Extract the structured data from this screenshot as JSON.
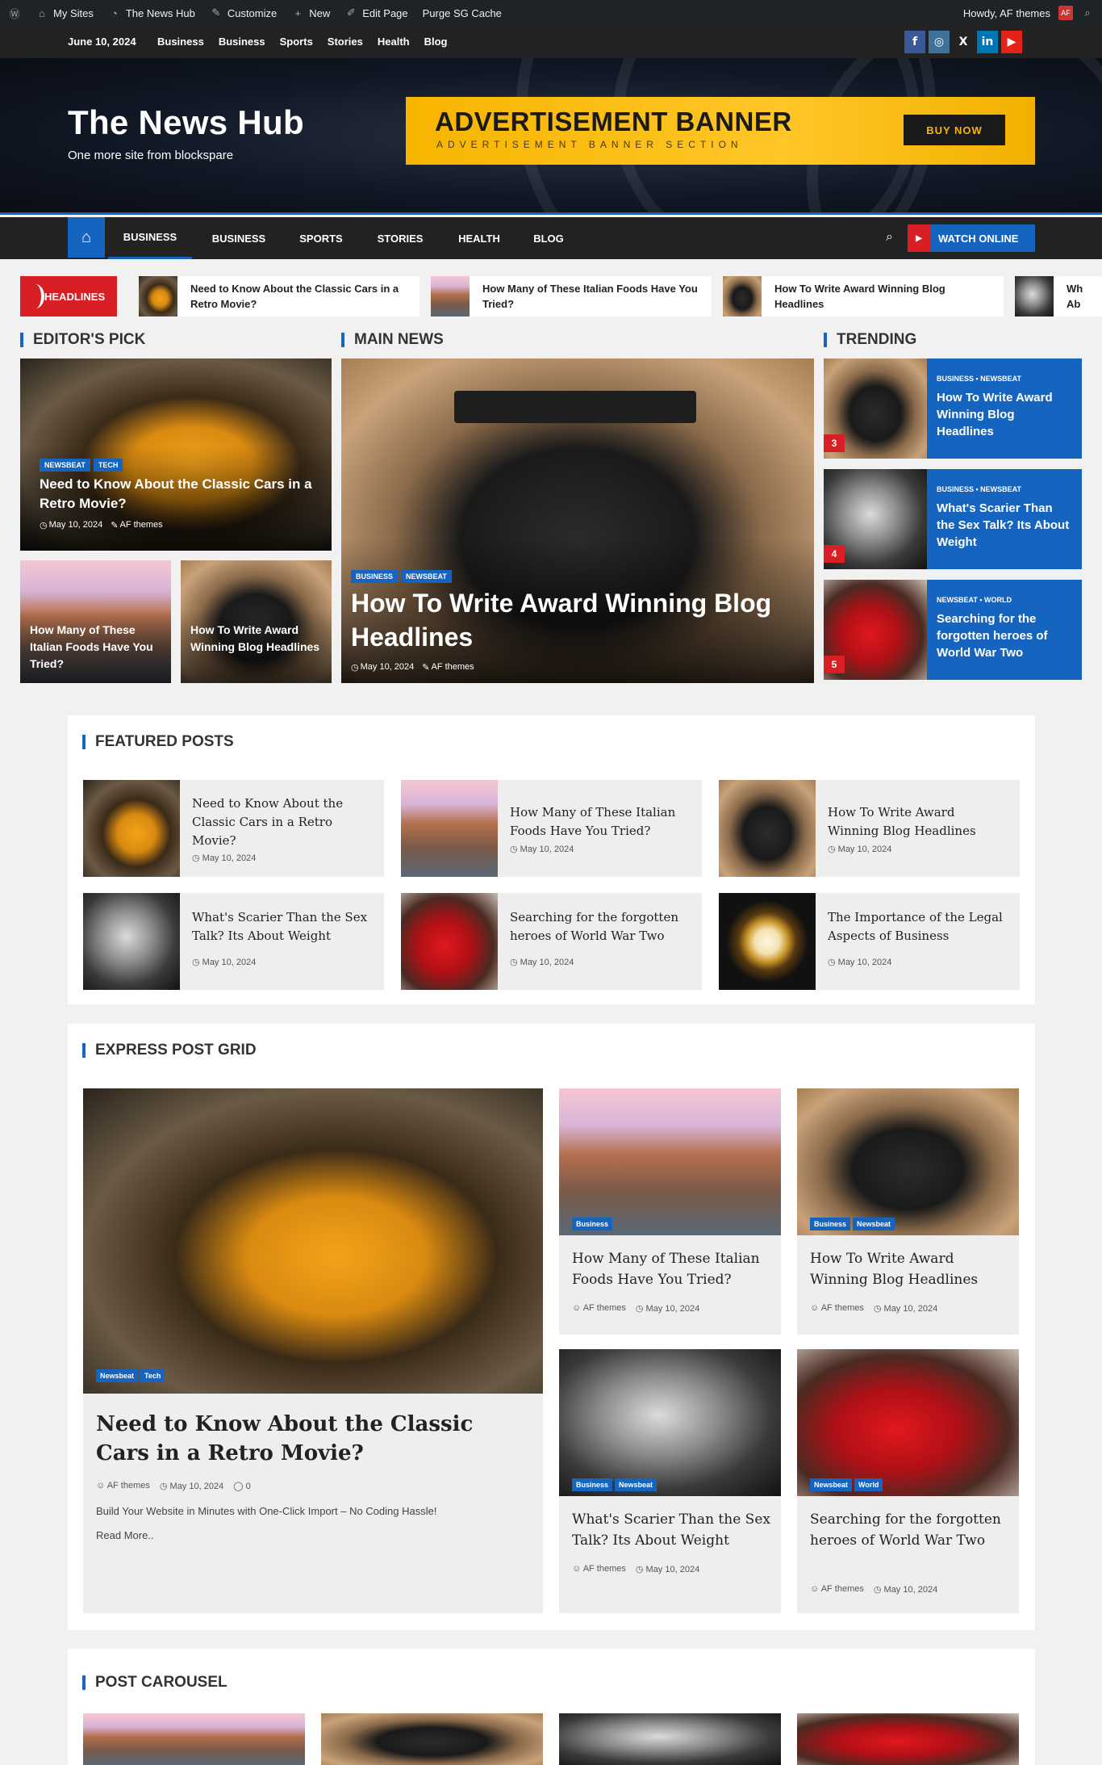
{
  "admin_bar": {
    "my_sites": "My Sites",
    "site_name": "The News Hub",
    "customize": "Customize",
    "new": "New",
    "edit_page": "Edit Page",
    "purge": "Purge SG Cache",
    "howdy": "Howdy, AF themes"
  },
  "top_bar": {
    "date": "June 10, 2024",
    "menu": [
      "Business",
      "Business",
      "Sports",
      "Stories",
      "Health",
      "Blog"
    ],
    "social": [
      "facebook-icon",
      "instagram-icon",
      "x-icon",
      "linkedin-icon",
      "youtube-icon"
    ],
    "social_labels": [
      "f",
      "◎",
      "X",
      "in",
      "▶"
    ]
  },
  "header": {
    "title": "The News Hub",
    "tagline": "One more site from blockspare",
    "ad_title": "ADVERTISEMENT BANNER",
    "ad_sub": "ADVERTISEMENT BANNER SECTION",
    "ad_button": "BUY NOW"
  },
  "nav": {
    "items": [
      "BUSINESS",
      "BUSINESS",
      "SPORTS",
      "STORIES",
      "HEALTH",
      "BLOG"
    ],
    "watch": "WATCH ONLINE"
  },
  "ticker": {
    "label": "HEADLINES",
    "items": [
      "Need to Know About the Classic Cars in a Retro Movie?",
      "How Many of These Italian Foods Have You Tried?",
      "How To Write Award Winning Blog Headlines",
      "Wh Ab"
    ]
  },
  "sections": {
    "editors_pick": "EDITOR'S PICK",
    "main_news": "MAIN NEWS",
    "trending": "TRENDING",
    "featured": "FEATURED POSTS",
    "express": "EXPRESS POST GRID",
    "carousel": "POST CAROUSEL"
  },
  "editors_pick": {
    "big": {
      "badges": [
        "NEWSBEAT",
        "TECH"
      ],
      "title": "Need to Know About the Classic Cars in a Retro Movie?",
      "date": "May 10, 2024",
      "author": "AF themes"
    },
    "small": [
      "How Many of These Italian Foods Have You Tried?",
      "How To Write Award Winning Blog Headlines"
    ]
  },
  "main_news": {
    "badges": [
      "BUSINESS",
      "NEWSBEAT"
    ],
    "title": "How To Write Award Winning Blog Headlines",
    "date": "May 10, 2024",
    "author": "AF themes"
  },
  "trending": [
    {
      "num": "3",
      "cats": "BUSINESS • NEWSBEAT",
      "title": "How To Write Award Winning Blog Headlines"
    },
    {
      "num": "4",
      "cats": "BUSINESS • NEWSBEAT",
      "title": "What's Scarier Than the Sex Talk? Its About Weight"
    },
    {
      "num": "5",
      "cats": "NEWSBEAT • WORLD",
      "title": "Searching for the forgotten heroes of World War Two"
    }
  ],
  "featured": [
    {
      "title": "Need to Know About the Classic Cars in a Retro Movie?",
      "date": "May 10, 2024"
    },
    {
      "title": "How Many of These Italian Foods Have You Tried?",
      "date": "May 10, 2024"
    },
    {
      "title": "How To Write Award Winning Blog Headlines",
      "date": "May 10, 2024"
    },
    {
      "title": "What's Scarier Than the Sex Talk? Its About Weight",
      "date": "May 10, 2024"
    },
    {
      "title": "Searching for the forgotten heroes of World War Two",
      "date": "May 10, 2024"
    },
    {
      "title": "The Importance of the Legal Aspects of Business",
      "date": "May 10, 2024"
    }
  ],
  "express": {
    "big": {
      "badges": [
        "Newsbeat",
        "Tech"
      ],
      "title": "Need to Know About the Classic Cars in a Retro Movie?",
      "author": "AF themes",
      "date": "May 10, 2024",
      "comments": "0",
      "excerpt": "Build Your Website in Minutes with One-Click Import – No Coding Hassle!",
      "read_more": "Read More.."
    },
    "cards": [
      {
        "badges": [
          "Business"
        ],
        "title": "How Many of These Italian Foods Have You Tried?",
        "author": "AF themes",
        "date": "May 10, 2024"
      },
      {
        "badges": [
          "Business",
          "Newsbeat"
        ],
        "title": "How To Write Award Winning Blog Headlines",
        "author": "AF themes",
        "date": "May 10, 2024"
      },
      {
        "badges": [
          "Business",
          "Newsbeat"
        ],
        "title": "What's Scarier Than the Sex Talk? Its About Weight",
        "author": "AF themes",
        "date": "May 10, 2024"
      },
      {
        "badges": [
          "Newsbeat",
          "World"
        ],
        "title": "Searching for the forgotten heroes of World War Two",
        "author": "AF themes",
        "date": "May 10, 2024"
      }
    ]
  },
  "colors": {
    "accent": "#1565c0",
    "red": "#d91f26",
    "dark": "#222222",
    "ad_yellow": "#ffc627"
  }
}
